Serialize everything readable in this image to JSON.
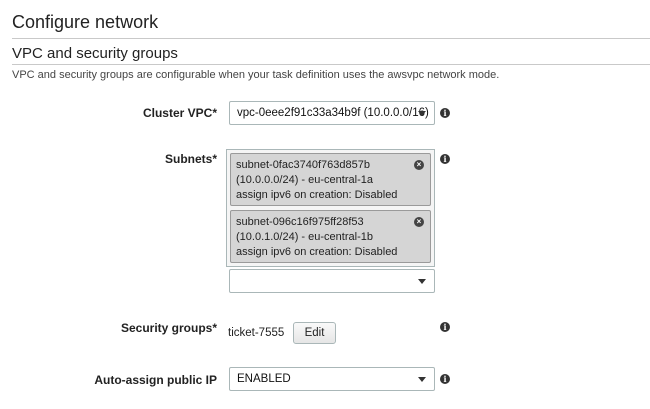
{
  "page_title": "Configure network",
  "section": {
    "title": "VPC and security groups",
    "description": "VPC and security groups are configurable when your task definition uses the awsvpc network mode."
  },
  "cluster_vpc": {
    "label": "Cluster VPC*",
    "value": "vpc-0eee2f91c33a34b9f (10.0.0.0/16)"
  },
  "subnets": {
    "label": "Subnets*",
    "items": [
      {
        "line1": "subnet-0fac3740f763d857b",
        "line2": "(10.0.0.0/24) - eu-central-1a",
        "line3": "assign ipv6 on creation: Disabled"
      },
      {
        "line1": "subnet-096c16f975ff28f53",
        "line2": "(10.0.1.0/24) - eu-central-1b",
        "line3": "assign ipv6 on creation: Disabled"
      }
    ],
    "add_value": ""
  },
  "security_groups": {
    "label": "Security groups*",
    "value": "ticket-7555",
    "edit_label": "Edit"
  },
  "auto_assign_ip": {
    "label": "Auto-assign public IP",
    "value": "ENABLED"
  },
  "icons": {
    "info": "info-icon",
    "remove": "remove-icon",
    "dropdown": "caret-down-icon"
  }
}
